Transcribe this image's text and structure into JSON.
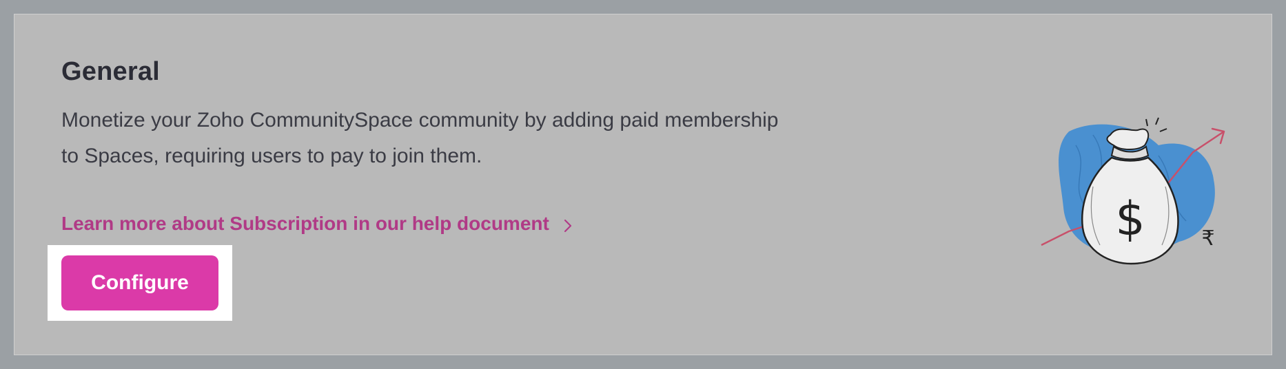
{
  "section": {
    "title": "General",
    "description": "Monetize your Zoho CommunitySpace community by adding paid membership to Spaces, requiring users to pay to join them.",
    "help_link_label": "Learn more about Subscription in our help document",
    "configure_label": "Configure"
  },
  "illustration": {
    "dollar_symbol": "$",
    "rupee_symbol": "₹",
    "icon": "money-bag-icon"
  },
  "colors": {
    "backdrop": "#9ba0a4",
    "card": "#b9b9b9",
    "accent": "#db3aa8",
    "link": "#b03a86",
    "blob": "#4a90d0",
    "arrow": "#c8506a"
  }
}
